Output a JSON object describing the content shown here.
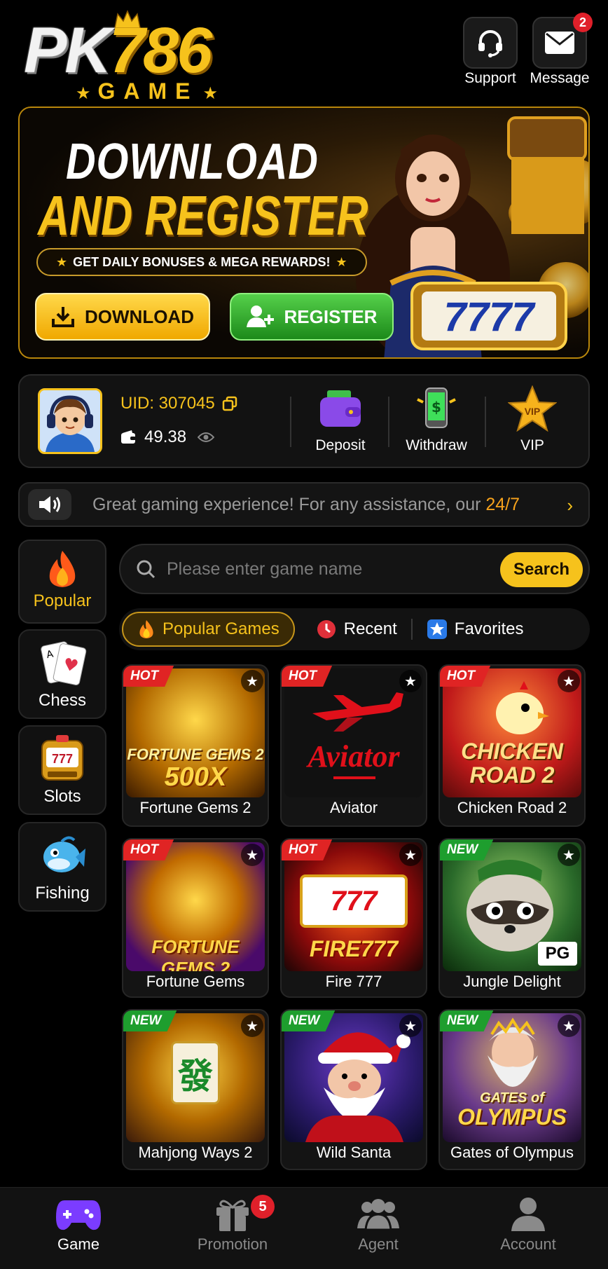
{
  "header": {
    "logo_main_pk": "PK",
    "logo_main_num": "786",
    "logo_sub": "GAME",
    "support_label": "Support",
    "message_label": "Message",
    "message_badge": "2"
  },
  "banner": {
    "title_line1": "DOWNLOAD",
    "title_line2": "AND REGISTER",
    "tagline": "GET DAILY BONUSES & MEGA REWARDS!",
    "download_label": "DOWNLOAD",
    "register_label": "REGISTER",
    "slot_digits": "7777"
  },
  "user": {
    "uid": "UID: 307045",
    "balance": "49.38",
    "deposit_label": "Deposit",
    "withdraw_label": "Withdraw",
    "vip_label": "VIP",
    "vip_icon_text": "VIP"
  },
  "notice": {
    "text": "Great gaming experience! For any assistance, our ",
    "highlight": "24/7"
  },
  "categories": [
    {
      "label": "Popular",
      "icon": "fire-icon"
    },
    {
      "label": "Chess",
      "icon": "cards-icon"
    },
    {
      "label": "Slots",
      "icon": "slot-machine-icon"
    },
    {
      "label": "Fishing",
      "icon": "fish-icon"
    }
  ],
  "search": {
    "placeholder": "Please enter game name",
    "button_label": "Search"
  },
  "tabs": [
    {
      "label": "Popular Games",
      "icon": "fire-icon",
      "active": true
    },
    {
      "label": "Recent",
      "icon": "clock-icon"
    },
    {
      "label": "Favorites",
      "icon": "star-icon"
    }
  ],
  "games": [
    {
      "name": "Fortune Gems 2",
      "tag": "HOT",
      "thumb_line1": "FORTUNE GEMS 2",
      "thumb_line2": "500X"
    },
    {
      "name": "Aviator",
      "tag": "HOT",
      "thumb_line1": "Aviator"
    },
    {
      "name": "Chicken Road 2",
      "tag": "HOT",
      "thumb_line1": "CHICKEN",
      "thumb_line2": "ROAD 2"
    },
    {
      "name": "Fortune Gems",
      "tag": "HOT",
      "thumb_line1": "FORTUNE GEMS 2"
    },
    {
      "name": "Fire 777",
      "tag": "HOT",
      "thumb_line1": "FIRE777"
    },
    {
      "name": "Jungle Delight",
      "tag": "NEW",
      "thumb_line1": "PG"
    },
    {
      "name": "Mahjong Ways 2",
      "tag": "NEW",
      "thumb_line1": "發"
    },
    {
      "name": "Wild Santa",
      "tag": "NEW"
    },
    {
      "name": "Gates of Olympus",
      "tag": "NEW",
      "thumb_line1": "GATES of",
      "thumb_line2": "OLYMPUS"
    }
  ],
  "bottom_nav": {
    "game": "Game",
    "promotion": "Promotion",
    "promotion_badge": "5",
    "agent": "Agent",
    "account": "Account"
  },
  "colors": {
    "accent": "#f6c21c",
    "hot": "#e02424",
    "new": "#1e9e2e",
    "game_nav_active": "#7b3cff"
  }
}
